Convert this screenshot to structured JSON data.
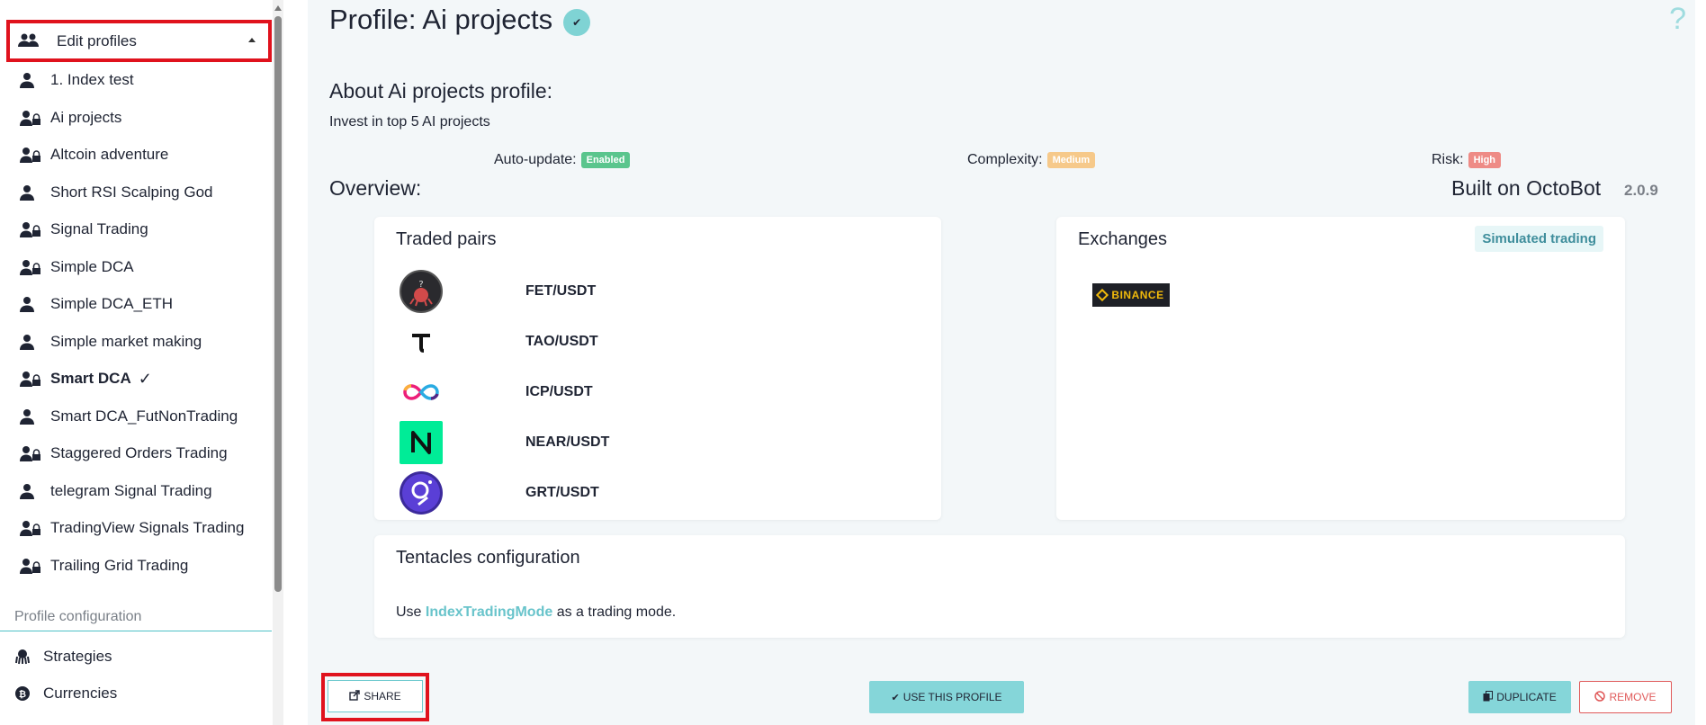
{
  "sidebar": {
    "header_label": "Edit profiles",
    "items": [
      {
        "label": "1. Index test",
        "icon": "user-icon",
        "active": false
      },
      {
        "label": "Ai projects",
        "icon": "user-lock-icon",
        "active": false
      },
      {
        "label": "Altcoin adventure",
        "icon": "user-lock-icon",
        "active": false
      },
      {
        "label": "Short RSI Scalping God",
        "icon": "user-icon",
        "active": false
      },
      {
        "label": "Signal Trading",
        "icon": "user-lock-icon",
        "active": false
      },
      {
        "label": "Simple DCA",
        "icon": "user-lock-icon",
        "active": false
      },
      {
        "label": "Simple DCA_ETH",
        "icon": "user-icon",
        "active": false
      },
      {
        "label": "Simple market making",
        "icon": "user-icon",
        "active": false
      },
      {
        "label": "Smart DCA",
        "icon": "user-lock-icon",
        "active": true,
        "check": "✓"
      },
      {
        "label": "Smart DCA_FutNonTrading",
        "icon": "user-icon",
        "active": false
      },
      {
        "label": "Staggered Orders Trading",
        "icon": "user-lock-icon",
        "active": false
      },
      {
        "label": "telegram Signal Trading",
        "icon": "user-icon",
        "active": false
      },
      {
        "label": "TradingView Signals Trading",
        "icon": "user-lock-icon",
        "active": false
      },
      {
        "label": "Trailing Grid Trading",
        "icon": "user-lock-icon",
        "active": false
      }
    ],
    "section_label": "Profile configuration",
    "config_items": [
      {
        "label": "Strategies",
        "icon": "octopus-icon"
      },
      {
        "label": "Currencies",
        "icon": "bitcoin-icon"
      }
    ]
  },
  "profile": {
    "title": "Profile: Ai projects",
    "about_heading": "About Ai projects profile:",
    "description": "Invest in top 5 AI projects",
    "auto_update_label": "Auto-update:",
    "auto_update_value": "Enabled",
    "complexity_label": "Complexity:",
    "complexity_value": "Medium",
    "risk_label": "Risk:",
    "risk_value": "High",
    "overview_heading": "Overview:",
    "built_on": "Built on OctoBot",
    "version": "2.0.9",
    "help_glyph": "?"
  },
  "traded_pairs": {
    "title": "Traded pairs",
    "pairs": [
      {
        "name": "FET/USDT",
        "icon": "fet-logo-icon"
      },
      {
        "name": "TAO/USDT",
        "icon": "tao-logo-icon"
      },
      {
        "name": "ICP/USDT",
        "icon": "icp-logo-icon"
      },
      {
        "name": "NEAR/USDT",
        "icon": "near-logo-icon"
      },
      {
        "name": "GRT/USDT",
        "icon": "grt-logo-icon"
      }
    ]
  },
  "exchanges": {
    "title": "Exchanges",
    "mode_badge": "Simulated trading",
    "exchange_logo_text": "BINANCE"
  },
  "tentacles": {
    "title": "Tentacles configuration",
    "text_before": "Use ",
    "mode_name": "IndexTradingMode",
    "text_after": " as a trading mode."
  },
  "actions": {
    "share": "SHARE",
    "use": "USE THIS PROFILE",
    "duplicate": "DUPLICATE",
    "remove": "REMOVE"
  },
  "colors": {
    "accent": "#85d6d9",
    "highlight_frame": "#e0121d",
    "enabled_badge": "#5ac58d",
    "medium_badge": "#f6c98a",
    "high_badge": "#ee8b86",
    "remove": "#e05a5a"
  }
}
